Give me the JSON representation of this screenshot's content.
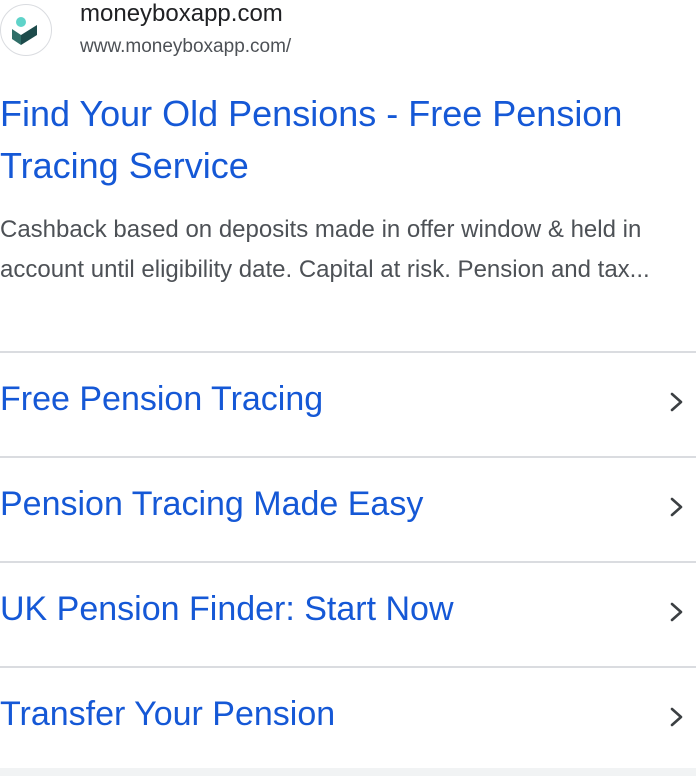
{
  "header": {
    "site_name": "moneyboxapp.com",
    "site_url": "www.moneyboxapp.com/",
    "favicon_icon": "moneybox-logo-icon"
  },
  "result": {
    "title": "Find Your Old Pensions - Free Pension Tracing Service",
    "description": "Cashback based on deposits made in offer window & held in account until eligibility date. Capital at risk. Pension and tax..."
  },
  "sitelinks": [
    {
      "label": "Free Pension Tracing",
      "icon": "chevron-right-icon"
    },
    {
      "label": "Pension Tracing Made Easy",
      "icon": "chevron-right-icon"
    },
    {
      "label": "UK Pension Finder: Start Now",
      "icon": "chevron-right-icon"
    },
    {
      "label": "Transfer Your Pension",
      "icon": "chevron-right-icon"
    }
  ],
  "colors": {
    "link": "#1558d6",
    "text": "#202124",
    "muted": "#4d5156",
    "divider": "#dadce0",
    "logo_dark": "#1d4b4b",
    "logo_teal": "#5fd3c9"
  }
}
